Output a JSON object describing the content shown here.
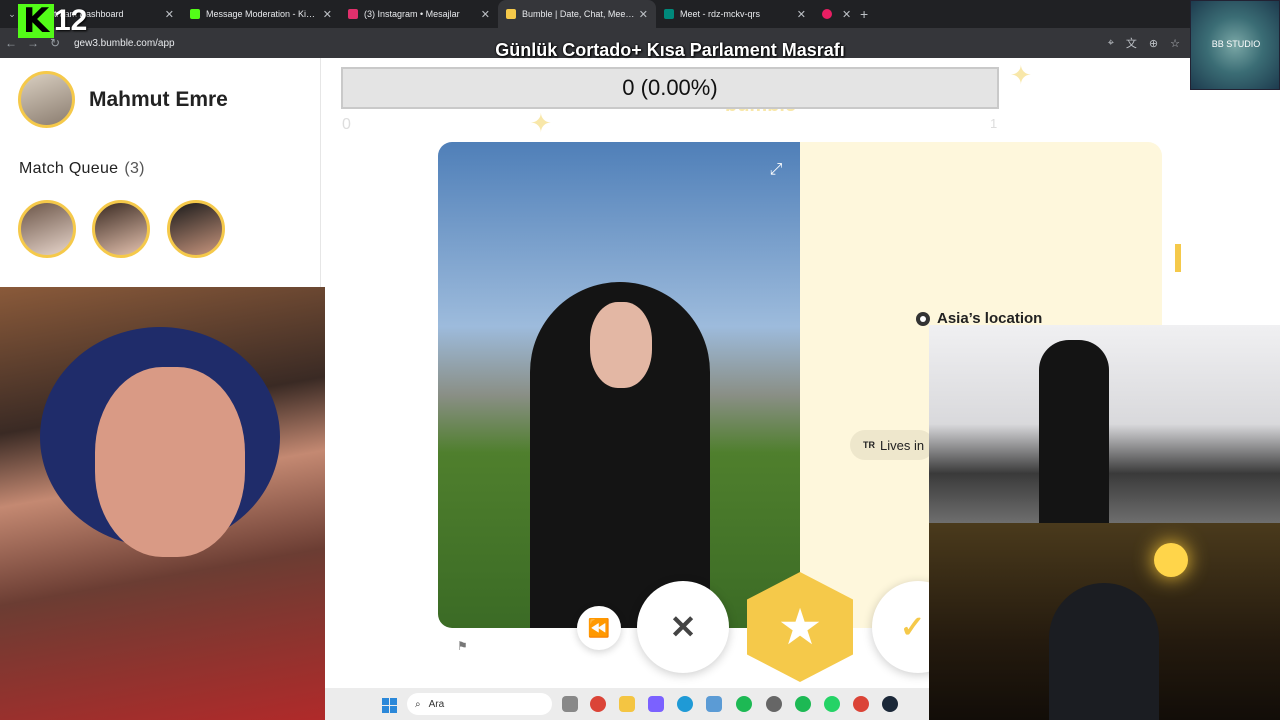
{
  "browser": {
    "tabs": [
      {
        "title": "Stream Dashboard",
        "icon": "kick-icon",
        "color": "#53fc18",
        "active": false
      },
      {
        "title": "Message Moderation - Kick Da",
        "icon": "kick-icon",
        "color": "#53fc18",
        "active": false
      },
      {
        "title": "(3) Instagram • Mesajlar",
        "icon": "instagram-icon",
        "color": "#e1306c",
        "active": false
      },
      {
        "title": "Bumble | Date, Chat, Meet New",
        "icon": "bumble-icon",
        "color": "#f5c94a",
        "active": true
      },
      {
        "title": "Meet - rdz-mckv-qrs",
        "icon": "meet-icon",
        "color": "#00897b",
        "active": false
      },
      {
        "title": "",
        "icon": "record-icon",
        "color": "#e91e63",
        "active": false
      }
    ],
    "url": "gew3.bumble.com/app"
  },
  "stream_overlay": {
    "title": "Günlük Cortado+ Kısa Parlament Masrafı",
    "badge_number": "12",
    "studio_label": "BB STUDIO",
    "progress_text": "0 (0.00%)",
    "progress_fraction": 0,
    "progress_left": "0",
    "progress_right": "1",
    "faded_brand": "bumble"
  },
  "sidebar": {
    "user_name": "Mahmut Emre",
    "match_queue_label": "Match Queue",
    "match_queue_count": "(3)"
  },
  "profile": {
    "location": "Asia’s location",
    "lives_in_country": "TR",
    "lives_in": "Lives in"
  },
  "taskbar": {
    "search_placeholder": "Ara"
  },
  "colors": {
    "bumble_yellow": "#f5c94a",
    "kick_green": "#53fc18",
    "chrome_dark": "#202124"
  }
}
